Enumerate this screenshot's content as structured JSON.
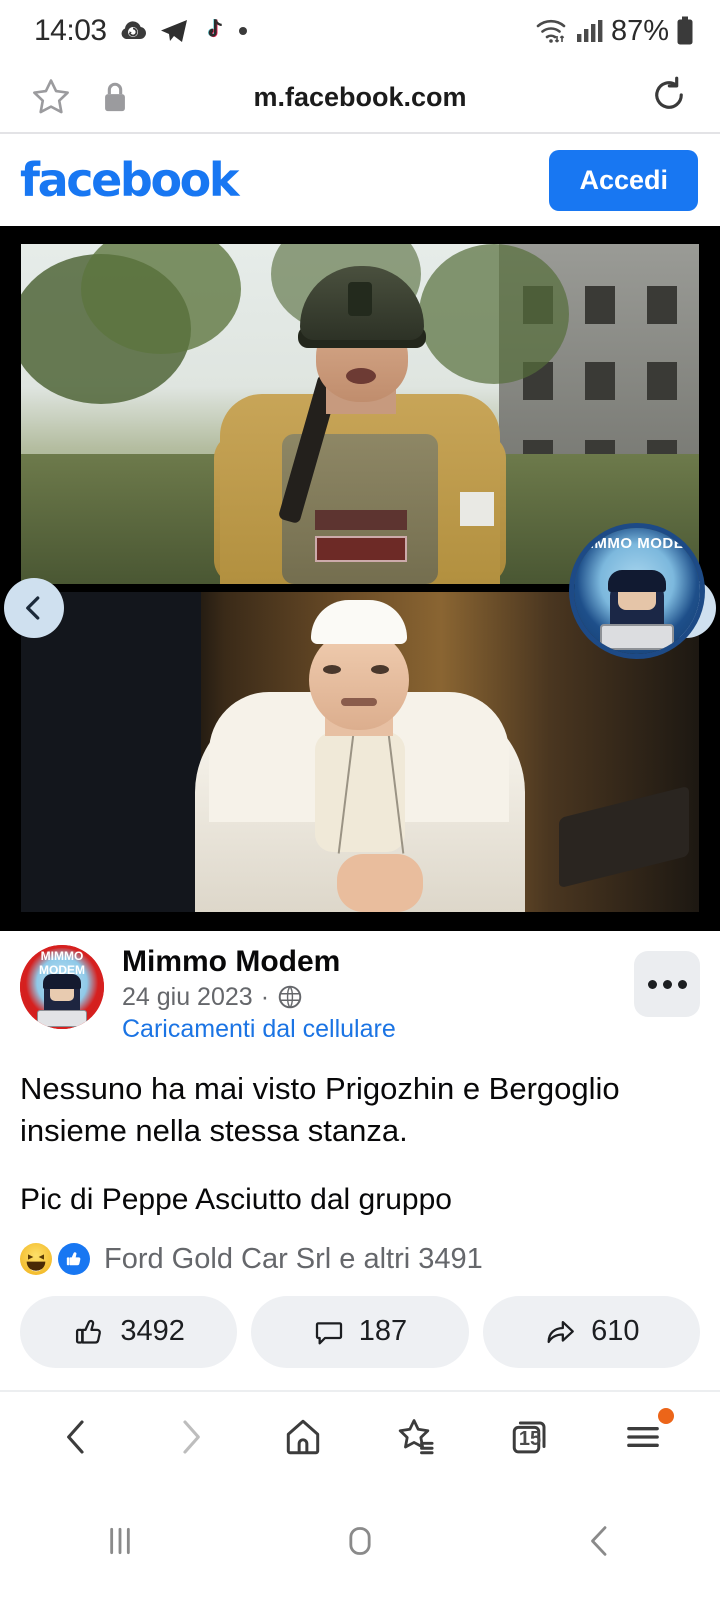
{
  "status_bar": {
    "time": "14:03",
    "battery_percent": "87%",
    "left_icons": [
      "cloud-sync-icon",
      "telegram-icon",
      "tiktok-icon",
      "dot-icon"
    ],
    "right_icons": [
      "wifi-icon",
      "cellular-signal-icon",
      "battery-icon"
    ]
  },
  "browser": {
    "url": "m.facebook.com",
    "bookmark_icon": "star-icon",
    "lock_icon": "lock-icon",
    "reload_icon": "reload-icon",
    "bottom_nav": {
      "back_label": "back-icon",
      "forward_label": "forward-icon",
      "home_label": "home-icon",
      "bookmarks_label": "bookmarks-icon",
      "tabs_count": "15",
      "menu_label": "menu-icon",
      "menu_has_badge": true
    }
  },
  "facebook": {
    "logo_text": "facebook",
    "login_button": "Accedi",
    "brand_color": "#1877f2"
  },
  "media": {
    "carousel_prev": "chevron-left-icon",
    "carousel_next": "chevron-right-icon",
    "watermark_text": "MIMMO MODEM",
    "top_image_alt": "Uomo con elmetto e giubbotto tattico",
    "bottom_image_alt": "Papa seduto con veste bianca"
  },
  "post": {
    "author": "Mimmo Modem",
    "date": "24 giu 2023",
    "privacy_icon": "globe-icon",
    "source_link": "Caricamenti dal cellulare",
    "menu_icon": "ellipsis-icon",
    "body_line1": "Nessuno ha mai visto Prigozhin e Bergoglio",
    "body_line2": "insieme nella stessa stanza.",
    "body2": "Pic di Peppe Asciutto dal gruppo",
    "reactions_text": "Ford Gold Car Srl e altri 3491",
    "reaction_icons": [
      "haha-icon",
      "like-icon"
    ],
    "actions": [
      {
        "icon": "thumbs-up-icon",
        "count": "3492"
      },
      {
        "icon": "comment-bubble-icon",
        "count": "187"
      },
      {
        "icon": "share-arrow-icon",
        "count": "610"
      }
    ]
  },
  "system_nav": {
    "recents": "recents-icon",
    "home": "home-circle-icon",
    "back": "back-chevron-icon"
  }
}
